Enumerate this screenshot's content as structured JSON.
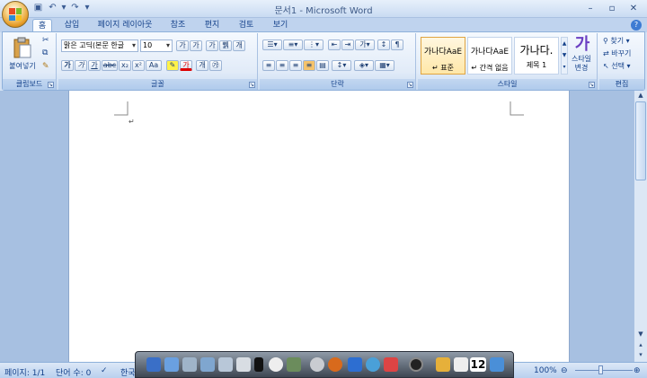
{
  "window": {
    "title": "문서1 - Microsoft Word",
    "controls": [
      "minimize",
      "maximize",
      "close"
    ]
  },
  "quick_access": [
    "save-icon",
    "undo-icon",
    "redo-icon",
    "customize-icon"
  ],
  "tabs": [
    "홈",
    "삽입",
    "페이지 레이아웃",
    "참조",
    "편지",
    "검토",
    "보기"
  ],
  "active_tab": "홈",
  "ribbon": {
    "clipboard": {
      "label": "클립보드",
      "paste": "붙여넣기"
    },
    "font": {
      "label": "글꼴",
      "font_name": "맑은 고딕(본문 한글",
      "font_size": "10",
      "row1_icons": [
        "가",
        "가",
        "가",
        "쀍",
        "개"
      ],
      "row2_icons": [
        "가",
        "가",
        "가",
        "abc",
        "x₂",
        "x²",
        "Aa"
      ]
    },
    "paragraph": {
      "label": "단락"
    },
    "styles": {
      "label": "스타일",
      "items": [
        {
          "sample": "가나다AaE",
          "name": "↵ 표준"
        },
        {
          "sample": "가나다AaE",
          "name": "↵ 간격 없음"
        },
        {
          "sample": "가나다.",
          "name": "제목 1"
        }
      ],
      "change_styles": "스타일 변경",
      "change_glyph": "가"
    },
    "editing": {
      "label": "편집",
      "find": "찾기",
      "replace": "바꾸기",
      "select": "선택"
    }
  },
  "document": {
    "paragraph_mark": "↵"
  },
  "status": {
    "page": "페이지: 1/1",
    "words": "단어 수: 0",
    "language": "한국어",
    "zoom": "100%"
  },
  "dock": {
    "badge": "12"
  },
  "colors": {
    "accent": "#15428b",
    "ribbon_bg": "#dbe6f5",
    "doc_bg": "#a7c0e1"
  }
}
